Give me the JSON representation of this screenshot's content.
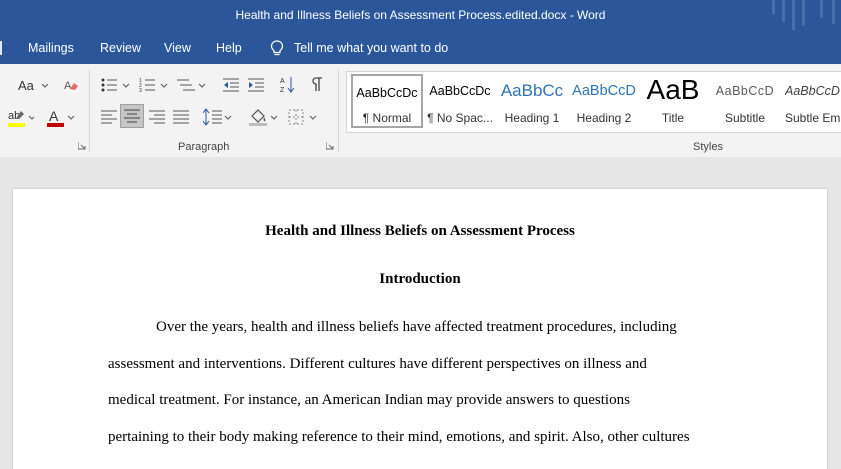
{
  "titlebar": {
    "title": "Health and Illness Beliefs on Assessment Process.edited.docx  -  Word"
  },
  "tabs": [
    {
      "label": "Mailings"
    },
    {
      "label": "Review"
    },
    {
      "label": "View"
    },
    {
      "label": "Help"
    }
  ],
  "tell_me": {
    "label": "Tell me what you want to do"
  },
  "font_group": {
    "change_case_label": "Aa"
  },
  "paragraph_group": {
    "label": "Paragraph"
  },
  "styles_group": {
    "label": "Styles",
    "items": [
      {
        "sample": "AaBbCcDc",
        "name": "¶ Normal"
      },
      {
        "sample": "AaBbCcDc",
        "name": "¶ No Spac..."
      },
      {
        "sample": "AaBbCc",
        "name": "Heading 1"
      },
      {
        "sample": "AaBbCcD",
        "name": "Heading 2"
      },
      {
        "sample": "AaB",
        "name": "Title"
      },
      {
        "sample": "AaBbCcD",
        "name": "Subtitle"
      },
      {
        "sample": "AaBbCcD",
        "name": "Subtle Em..."
      }
    ]
  },
  "colors": {
    "word_blue": "#2b579a",
    "highlight": "#ffff00",
    "font_color": "#c00000",
    "heading_blue": "#2e74b5"
  },
  "document": {
    "title": "Health and Illness Beliefs on Assessment Process",
    "section_heading": "Introduction",
    "lines": [
      "Over the years, health and illness beliefs have affected treatment procedures, including",
      "assessment and interventions. Different cultures have different perspectives on illness and",
      "medical treatment. For instance, an American Indian may provide answers to questions",
      "pertaining to their body making reference to their mind, emotions, and spirit. Also, other cultures"
    ]
  }
}
